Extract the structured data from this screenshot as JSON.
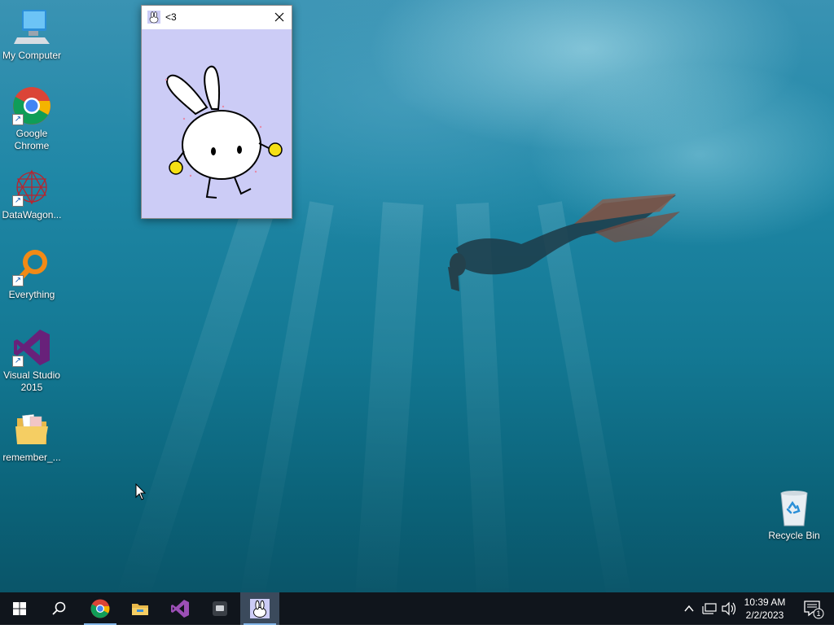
{
  "desktop": {
    "icons": [
      {
        "label": "My Computer",
        "icon": "computer-icon",
        "shortcut": false
      },
      {
        "label": "Google Chrome",
        "icon": "chrome-icon",
        "shortcut": true
      },
      {
        "label": "DataWagon...",
        "icon": "datawagon-icon",
        "shortcut": true
      },
      {
        "label": "Everything",
        "icon": "everything-search-icon",
        "shortcut": true
      },
      {
        "label": "Visual Studio 2015",
        "icon": "visual-studio-icon",
        "shortcut": true
      },
      {
        "label": "remember_...",
        "icon": "folder-icon",
        "shortcut": false
      }
    ],
    "recycle_bin": {
      "label": "Recycle Bin",
      "icon": "recycle-bin-icon"
    }
  },
  "window": {
    "title": "<3",
    "icon": "bunny-icon",
    "close_icon": "close-icon",
    "background": "#ccccf6"
  },
  "taskbar": {
    "start_icon": "windows-start-icon",
    "search_icon": "search-icon",
    "apps": [
      {
        "icon": "chrome-icon",
        "running": true,
        "active": false
      },
      {
        "icon": "file-explorer-icon",
        "running": false,
        "active": false
      },
      {
        "icon": "visual-studio-icon",
        "running": false,
        "active": false
      },
      {
        "icon": "app-window-icon",
        "running": false,
        "active": false
      },
      {
        "icon": "bunny-icon",
        "running": true,
        "active": true
      }
    ],
    "tray": {
      "overflow_icon": "chevron-up-icon",
      "network_icon": "network-icon",
      "volume_icon": "volume-icon",
      "notification_icon": "notification-icon",
      "notification_count": "1"
    },
    "clock": {
      "time": "10:39 AM",
      "date": "2/2/2023"
    }
  },
  "colors": {
    "taskbar": "#10151c",
    "active_underline": "#7fb3e6",
    "bunny_cheeks": "#f5e014"
  }
}
